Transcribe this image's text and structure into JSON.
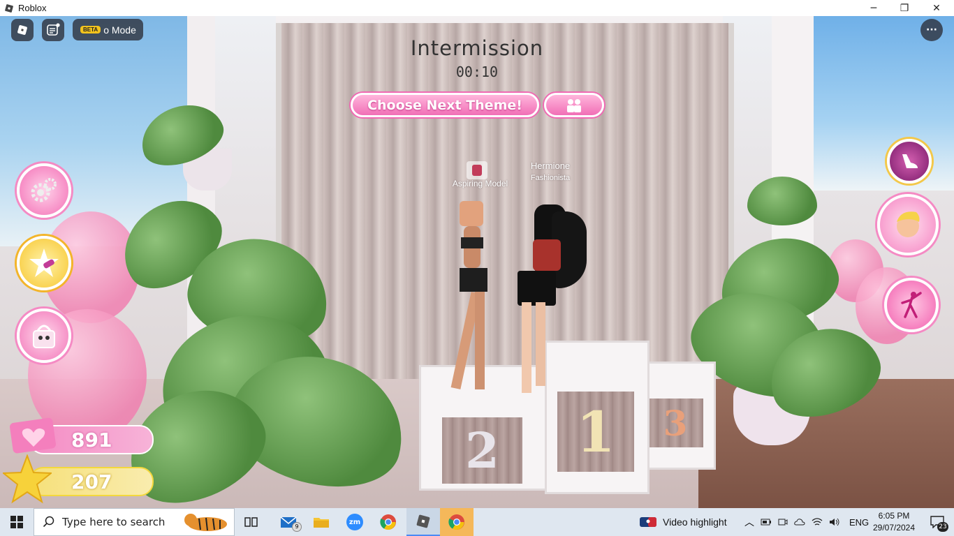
{
  "window": {
    "title": "Roblox",
    "minimize": "─",
    "maximize": "❐",
    "close": "✕"
  },
  "roblox_hud": {
    "mode_beta_badge": "BETA",
    "mode_label": "o Mode",
    "menu_dots": "···"
  },
  "game": {
    "intermission_title": "Intermission",
    "timer": "00:10",
    "choose_theme_label": "Choose Next Theme!",
    "podium_numbers": [
      "2",
      "1",
      "3"
    ],
    "player1_rank": "Aspiring Model",
    "player2_name": "Hermione",
    "player2_rank": "Fashionista",
    "currency_hearts": "891",
    "currency_stars": "207",
    "colors": {
      "accent_pink": "#f16fb6",
      "gold": "#f7d94a"
    }
  },
  "taskbar": {
    "search_placeholder": "Type here to search",
    "mail_badge": "9",
    "zoom_label": "zm",
    "news_label": "Video highlight",
    "language": "ENG",
    "time": "6:05 PM",
    "date": "29/07/2024",
    "notifications_count": "23"
  }
}
